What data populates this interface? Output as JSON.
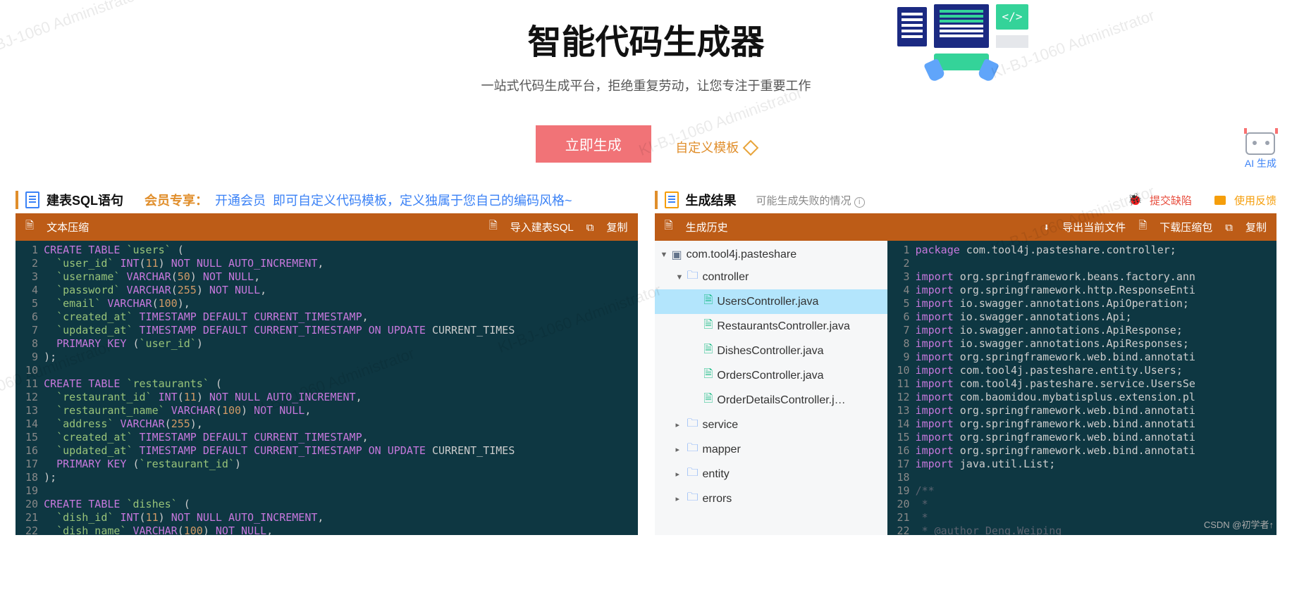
{
  "watermark": "KI-BJ-1060  Administrator",
  "header": {
    "title": "智能代码生成器",
    "subtitle": "一站式代码生成平台，拒绝重复劳动，让您专注于重要工作",
    "artTag": "</>"
  },
  "actions": {
    "generate": "立即生成",
    "customTemplate": "自定义模板",
    "aiGen": "AI 生成"
  },
  "leftPanel": {
    "title": "建表SQL语句",
    "memberPrefix": "会员专享：",
    "memberLink": "开通会员",
    "memberTail": " 即可自定义代码模板，定义独属于您自己的编码风格~",
    "toolbar": {
      "compress": "文本压缩",
      "import": "导入建表SQL",
      "copy": "复制"
    }
  },
  "rightPanel": {
    "title": "生成结果",
    "failHint": "可能生成失败的情况",
    "reportBug": "提交缺陷",
    "feedback": "使用反馈",
    "toolbar": {
      "history": "生成历史",
      "exportCurrent": "导出当前文件",
      "downloadZip": "下载压缩包",
      "copy": "复制"
    }
  },
  "tree": {
    "root": "com.tool4j.pasteshare",
    "folders": [
      "controller",
      "service",
      "mapper",
      "entity",
      "errors"
    ],
    "controllerFiles": [
      "UsersController.java",
      "RestaurantsController.java",
      "DishesController.java",
      "OrdersController.java",
      "OrderDetailsController.j…"
    ]
  },
  "sql": [
    "CREATE TABLE `users` (",
    "  `user_id` INT(11) NOT NULL AUTO_INCREMENT,",
    "  `username` VARCHAR(50) NOT NULL,",
    "  `password` VARCHAR(255) NOT NULL,",
    "  `email` VARCHAR(100),",
    "  `created_at` TIMESTAMP DEFAULT CURRENT_TIMESTAMP,",
    "  `updated_at` TIMESTAMP DEFAULT CURRENT_TIMESTAMP ON UPDATE CURRENT_TIMES",
    "  PRIMARY KEY (`user_id`)",
    ");",
    "",
    "CREATE TABLE `restaurants` (",
    "  `restaurant_id` INT(11) NOT NULL AUTO_INCREMENT,",
    "  `restaurant_name` VARCHAR(100) NOT NULL,",
    "  `address` VARCHAR(255),",
    "  `created_at` TIMESTAMP DEFAULT CURRENT_TIMESTAMP,",
    "  `updated_at` TIMESTAMP DEFAULT CURRENT_TIMESTAMP ON UPDATE CURRENT_TIMES",
    "  PRIMARY KEY (`restaurant_id`)",
    ");",
    "",
    "CREATE TABLE `dishes` (",
    "  `dish_id` INT(11) NOT NULL AUTO_INCREMENT,",
    "  `dish_name` VARCHAR(100) NOT NULL,"
  ],
  "java": [
    "package com.tool4j.pasteshare.controller;",
    "",
    "import org.springframework.beans.factory.ann",
    "import org.springframework.http.ResponseEnti",
    "import io.swagger.annotations.ApiOperation;",
    "import io.swagger.annotations.Api;",
    "import io.swagger.annotations.ApiResponse;",
    "import io.swagger.annotations.ApiResponses;",
    "import org.springframework.web.bind.annotati",
    "import com.tool4j.pasteshare.entity.Users;",
    "import com.tool4j.pasteshare.service.UsersSe",
    "import com.baomidou.mybatisplus.extension.pl",
    "import org.springframework.web.bind.annotati",
    "import org.springframework.web.bind.annotati",
    "import org.springframework.web.bind.annotati",
    "import org.springframework.web.bind.annotati",
    "import java.util.List;",
    "",
    "/**",
    " *",
    " *",
    " * @author Deng.Weiping"
  ],
  "footer": "CSDN @初学者↑"
}
